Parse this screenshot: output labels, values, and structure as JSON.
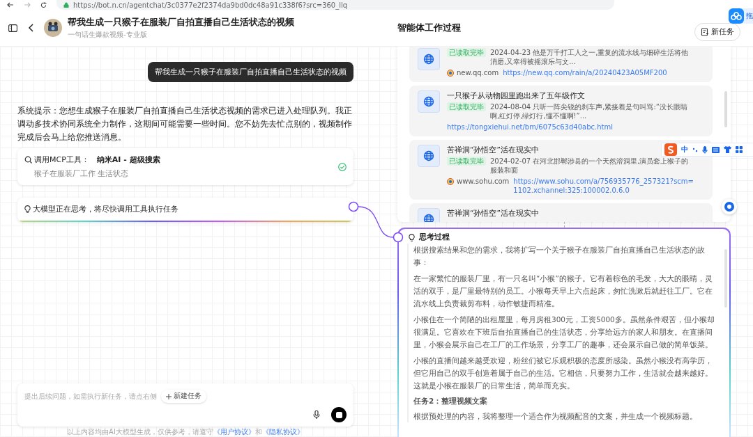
{
  "browser": {
    "url": "https://bot.n.cn/agentchat/3c0377e2f2374da9bd0dc48a91c338f6?src=360_llq"
  },
  "header": {
    "title": "帮我生成一只猴子在服装厂自拍直播自己生活状态的视频",
    "subtitle": "一句话生爆款视频-专业版",
    "panel_title": "智能体工作过程",
    "new_task_button": "新任务"
  },
  "floating_button": {
    "label": "拖"
  },
  "chat": {
    "user_message": "帮我生成一只猴子在服装厂自拍直播自己生活状态的视频",
    "system_message": "系统提示：您想生成猴子在服装厂自拍直播自己生活状态视频的需求已进入处理队列。我正调动多技术协同系统全力制作，这期间可能需要一些时间。您不妨先去忙点别的，视频制作完成后会马上给您推送消息。",
    "tool_call": {
      "label": "调用MCP工具：",
      "tool": "纳米AI - 超级搜索",
      "query": "猴子在服装厂工作 生活状态",
      "done": true
    },
    "status": {
      "text": "大模型正在思考，将尽快调用工具执行任务"
    }
  },
  "input": {
    "placeholder": "提出后续问题，如需执行新任务，请点右侧",
    "new_task_button": "新建任务"
  },
  "footer": {
    "text": "以上内容均由AI大模型生成，仅供参考，请遵守",
    "links": [
      "《用户协议》",
      "《隐私协议》"
    ],
    "joiner": "和"
  },
  "search_results": [
    {
      "tag": "已读取完毕",
      "snippet": "2024-04-23 他是万千打工人之一,重复的流水线与细碎生活将他消磨,又幸得被摇滚乐与文...",
      "source": "new.qq.com",
      "url": "https://new.qq.com/rain/a/20240423A05MF200"
    },
    {
      "title": "一只猴子从动物园里跑出来了五年级作文",
      "tag": "已读取完毕",
      "snippet": "2024-08-04 只听一阵尖锐的刹车声,紧接着是句叫骂:“没长眼睛啊,红灯停,绿灯行,懂不懂啊!”...",
      "url": "https://tongxiehui.net/bm/6075c63d40abc.html"
    },
    {
      "title": "苦禅洞“孙悟空”活在现实中",
      "tag": "已读取完毕",
      "snippet": "2024-02-07 在河北邯郸涉县的一个天然溶洞里,演员套上猴子的服装和面",
      "source": "www.sohu.com",
      "url": "https://www.sohu.com/a/756935776_257321?scm=1102.xchannel:325:100002.0.6.0"
    },
    {
      "title": "苦禅洞“孙悟空”活在现实中"
    }
  ],
  "thinking": {
    "title": "思考过程",
    "blocks": [
      {
        "kind": "paragraph",
        "text": "根据搜索结果和您的需求，我将扩写一个关于猴子在服装厂自拍直播自己生活状态的故事："
      },
      {
        "kind": "paragraph",
        "text": "在一家繁忙的服装厂里，有一只名叫“小猴”的猴子。它有着棕色的毛发，大大的眼睛，灵活的双手，是厂里最特别的员工。小猴每天早上六点起床，匆忙洗漱后就赶往工厂。它在流水线上负责裁剪布料，动作敏捷而精准。"
      },
      {
        "kind": "paragraph",
        "text": "小猴住在一个简陋的出租屋里，每月房租300元，工资5000多。虽然条件艰苦，但小猴却很满足。它喜欢在下班后自拍直播自己的生活状态，分享给远方的家人和朋友。在直播间里，小猴会展示自己在工厂的工作场景，分享工厂的趣事，还会展示自己做的简单饭菜。"
      },
      {
        "kind": "paragraph",
        "text": "小猴的直播间越来越受欢迎，粉丝们被它乐观积极的态度所感染。虽然小猴没有高学历，但它用自己的双手创造着属于自己的生活。它相信，只要努力工作，生活就会越来越好。这就是小猴在服装厂的日常生活，简单而充实。"
      },
      {
        "kind": "heading",
        "text": "任务2：整理视频文案"
      },
      {
        "kind": "paragraph",
        "text": "根据预处理的内容，我将整理一个适合作为视频配音的文案，并生成一个视频标题。"
      }
    ]
  },
  "ime": {
    "label": "中"
  }
}
